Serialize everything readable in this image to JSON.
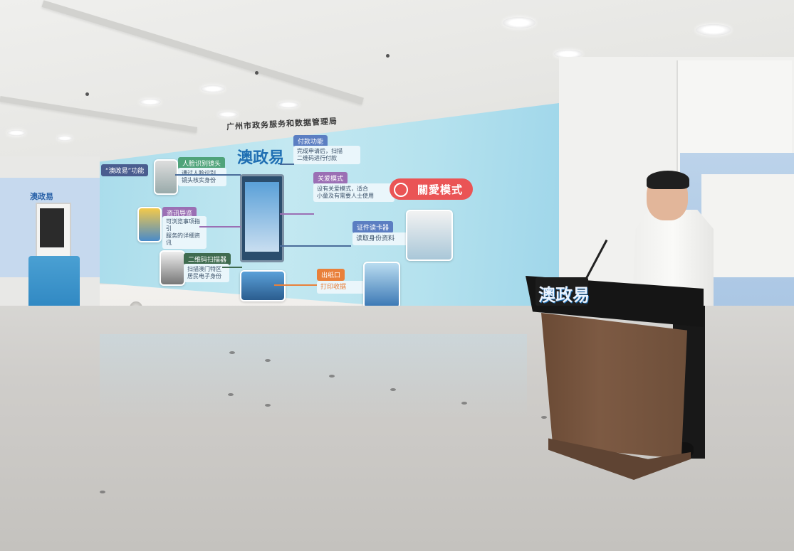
{
  "signage": {
    "agency": "广州市政务服务和数据管理局",
    "podium_logo": "澳政易",
    "kiosk_sign": "澳政易"
  },
  "screen": {
    "logo": "澳政易",
    "features_tag": "“澳政易”功能",
    "items": [
      {
        "title": "人脸识别镜头",
        "desc": "通过人脸识别\n镜头核实身份"
      },
      {
        "title": "资讯导览",
        "desc": "可浏览事项指引\n服务的详细资讯"
      },
      {
        "title": "二维码扫描器",
        "desc": "扫描澳门特区\n居民电子身份"
      },
      {
        "title": "付款功能",
        "desc": "完成申请后，扫描\n二维码进行付款"
      },
      {
        "title": "关爱模式",
        "desc": "设有关爱模式，适合\n小童及有需要人士使用"
      },
      {
        "title": "证件读卡器",
        "desc": "读取身份资料"
      },
      {
        "title": "出纸口",
        "desc": "打印收据"
      }
    ],
    "care_badge": "關愛模式"
  },
  "colors": {
    "screen_bg": "#b5e2ee",
    "tag_blue": "#5b7ec2",
    "tag_purple": "#9b6fb4",
    "tag_green": "#4fa37a",
    "tag_orange": "#e9803a",
    "care_red": "#ea5455",
    "podium_wood": "#7d5a43"
  }
}
